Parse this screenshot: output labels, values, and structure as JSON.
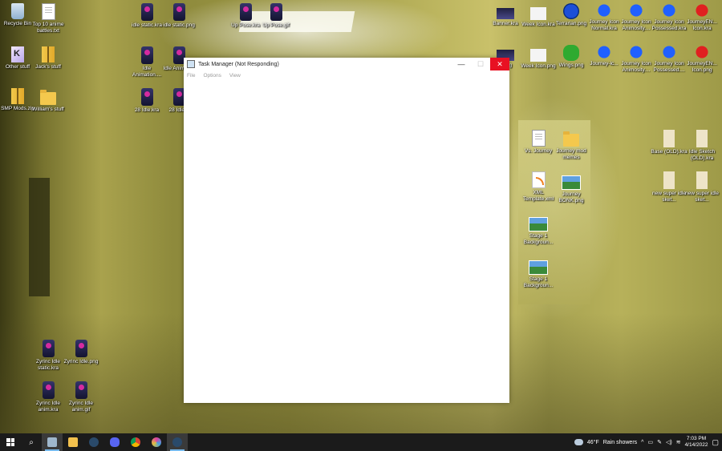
{
  "desktop": {
    "icons": [
      {
        "id": "recycle-bin",
        "label": "Recycle Bin",
        "kind": "bin"
      },
      {
        "id": "top10",
        "label": "Top 10 anime battles.txt",
        "kind": "txt"
      },
      {
        "id": "other-stuff",
        "label": "Other stuff",
        "kind": "sc"
      },
      {
        "id": "jacks-stuff",
        "label": "Jack's stuff",
        "kind": "zip"
      },
      {
        "id": "smp-mods",
        "label": "SMP Mods.zip",
        "kind": "zip"
      },
      {
        "id": "williams-stuff",
        "label": "William's stuff",
        "kind": "folder"
      },
      {
        "id": "idle-static-kra",
        "label": "idle static.kra",
        "kind": "kra"
      },
      {
        "id": "idle-static-png",
        "label": "idle static.png",
        "kind": "kra"
      },
      {
        "id": "up-pose-kra",
        "label": "Up Pose.kra",
        "kind": "kra"
      },
      {
        "id": "up-pose-gif",
        "label": "Up Pose.gif",
        "kind": "kra"
      },
      {
        "id": "idle-animation-1",
        "label": "Idle Animation....",
        "kind": "kra"
      },
      {
        "id": "idle-animation-2",
        "label": "Idle Animati...",
        "kind": "kra"
      },
      {
        "id": "28-idle-kra",
        "label": "28 Idle.kra",
        "kind": "kra"
      },
      {
        "id": "28-idle-2",
        "label": "28 Idle...",
        "kind": "kra"
      },
      {
        "id": "banner",
        "label": "Banner.kra",
        "kind": "banner"
      },
      {
        "id": "week-icon-kra",
        "label": "Week Icon.kra",
        "kind": "week"
      },
      {
        "id": "terrarian",
        "label": "Terrarian.png",
        "kind": "terrarian"
      },
      {
        "id": "journey-icon-normal",
        "label": "Journey Icon Normal.kra",
        "kind": "blue"
      },
      {
        "id": "journey-icon-animosity",
        "label": "Journey Icon Animosity....",
        "kind": "blue"
      },
      {
        "id": "journey-icon-possessed",
        "label": "Journey Icon Possessed.kra",
        "kind": "blue"
      },
      {
        "id": "journeyen-icon-kra",
        "label": "JourneyEN... Icon.kra",
        "kind": "red"
      },
      {
        "id": "banner-png",
        "label": "...png",
        "kind": "banner"
      },
      {
        "id": "week-icon-png",
        "label": "Week Icon.png",
        "kind": "week"
      },
      {
        "id": "wings",
        "label": "Wings.png",
        "kind": "wings"
      },
      {
        "id": "journey-ic",
        "label": "Journey-ic...",
        "kind": "blue"
      },
      {
        "id": "journey-icon-animosity-2",
        "label": "Journey Icon Animosity....",
        "kind": "blue"
      },
      {
        "id": "journey-icon-possessed-2",
        "label": "Journey Icon Possessed....",
        "kind": "blue"
      },
      {
        "id": "journeyen-icon-png",
        "label": "JourneyEN... Icon.png",
        "kind": "red"
      },
      {
        "id": "vs-journey",
        "label": "Vs. Journey",
        "kind": "txt"
      },
      {
        "id": "journey-mod-memes",
        "label": "Journey mod memes",
        "kind": "folder"
      },
      {
        "id": "base-old",
        "label": "Base (OLD).kra",
        "kind": "sketch"
      },
      {
        "id": "idle-sketch-old",
        "label": "Idle Sketch (OLD).kra",
        "kind": "sketch"
      },
      {
        "id": "xml-template",
        "label": "XML Template.xml",
        "kind": "rss"
      },
      {
        "id": "journey-bonk",
        "label": "Journey BONK.png",
        "kind": "photo"
      },
      {
        "id": "new-super-idle-1",
        "label": "new super idle sket...",
        "kind": "sketch"
      },
      {
        "id": "new-super-idle-2",
        "label": "new super idle sket...",
        "kind": "sketch"
      },
      {
        "id": "stage1-bg-1",
        "label": "Stage 1 Backgroun...",
        "kind": "photo"
      },
      {
        "id": "stage1-bg-2",
        "label": "Stage 1 Backgroun...",
        "kind": "photo"
      },
      {
        "id": "zyrinc-idle-static-kra",
        "label": "Zyrinc Idle static.kra",
        "kind": "kra"
      },
      {
        "id": "zyrinc-idle-png",
        "label": "Zyrinc Idle.png",
        "kind": "kra"
      },
      {
        "id": "zyrinc-idle-anim-kra",
        "label": "Zyrinc Idle anim.kra",
        "kind": "kra"
      },
      {
        "id": "zyrinc-idle-anim-gif",
        "label": "Zyrinc Idle anim.gif",
        "kind": "kra"
      }
    ]
  },
  "window": {
    "title": "Task Manager (Not Responding)",
    "menu": [
      "File",
      "Options",
      "View"
    ],
    "controls": {
      "minimize": "—",
      "maximize": "☐",
      "close": "✕"
    }
  },
  "taskbar": {
    "apps": [
      "start",
      "search",
      "task-manager",
      "file-explorer",
      "steam",
      "discord",
      "chrome",
      "app-circle",
      "steam-2"
    ],
    "weather": {
      "temp": "46°F",
      "desc": "Rain showers"
    },
    "clock": {
      "time": "7:03 PM",
      "date": "4/14/2022"
    }
  }
}
